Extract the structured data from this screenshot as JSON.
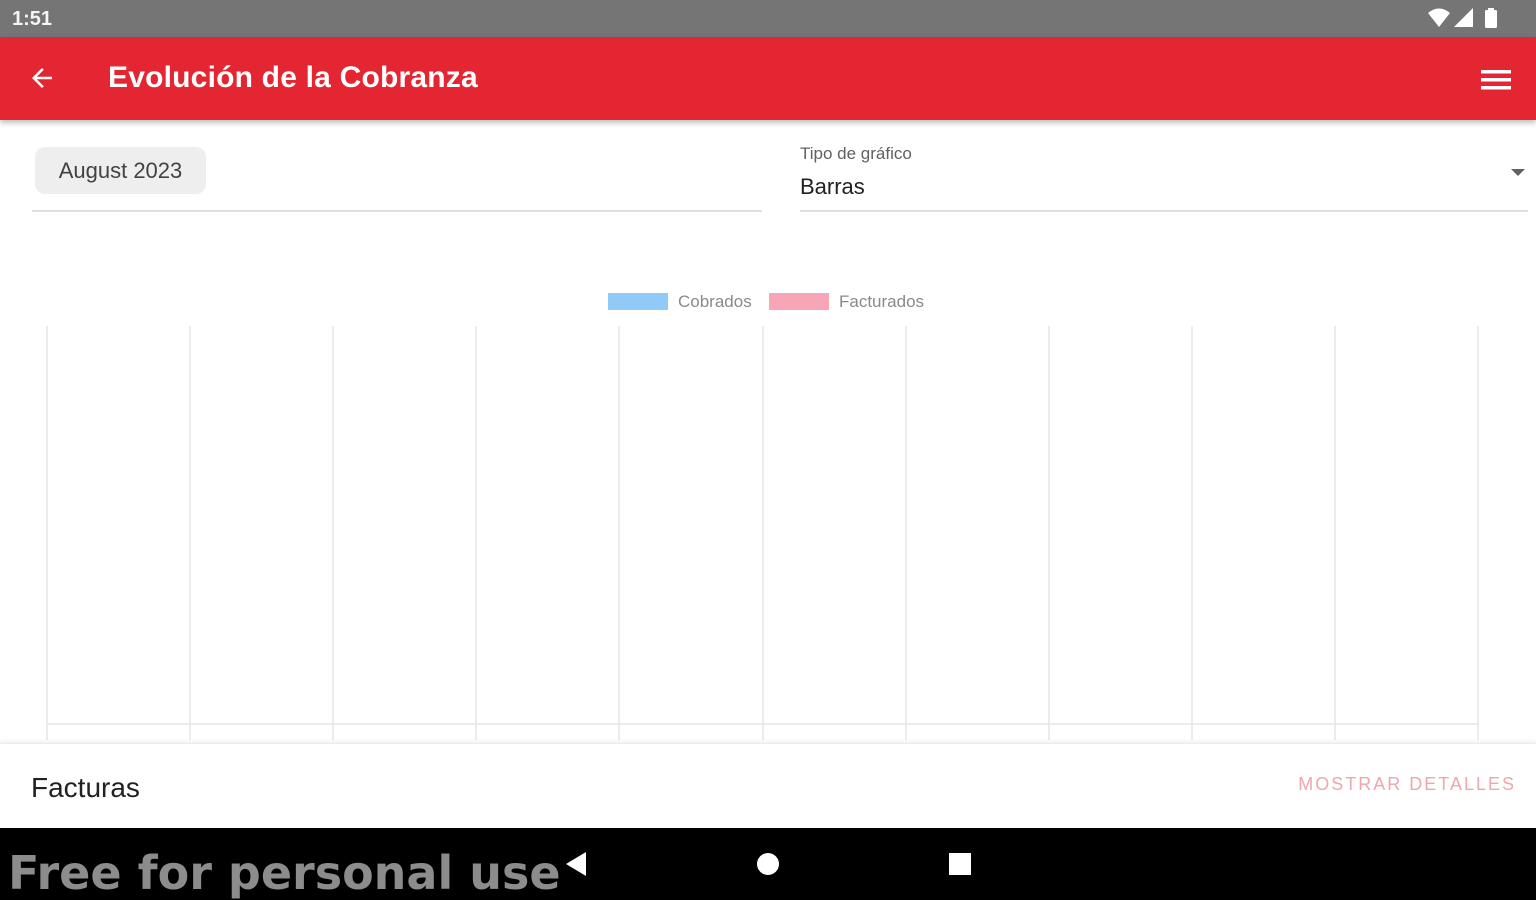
{
  "status_bar": {
    "time": "1:51",
    "icons": [
      "wifi-icon",
      "signal-icon",
      "battery-icon"
    ]
  },
  "app_bar": {
    "title": "Evolución de la Cobranza",
    "back_icon": "arrow-left-icon",
    "menu_icon": "hamburger-menu-icon",
    "color": "#e32631"
  },
  "filters": {
    "date": "August 2023",
    "chart_type_label": "Tipo de gráfico",
    "chart_type_value": "Barras"
  },
  "chart_data": {
    "type": "bar",
    "title": "",
    "xlabel": "",
    "ylabel": "",
    "categories": [],
    "series": [
      {
        "name": "Cobrados",
        "color": "#90caf9",
        "values": []
      },
      {
        "name": "Facturados",
        "color": "#f8a5b8",
        "values": []
      }
    ],
    "grid": true,
    "vertical_gridlines": 11,
    "legend_position": "top-center"
  },
  "bottom_panel": {
    "title": "Facturas",
    "details_button": "MOSTRAR DETALLES"
  },
  "nav_bar": {
    "watermark": "Free for personal use",
    "buttons": [
      "back-triangle-icon",
      "home-circle-icon",
      "recents-square-icon"
    ]
  }
}
